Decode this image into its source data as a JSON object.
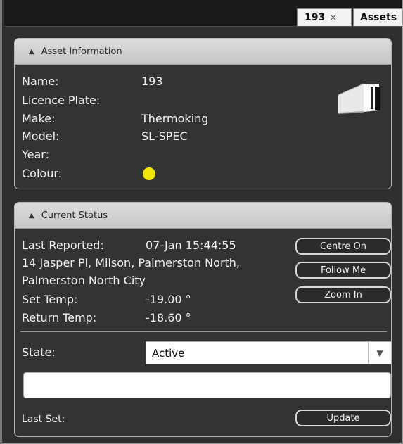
{
  "tabs": [
    {
      "label": "193",
      "close": "×"
    },
    {
      "label": "Assets"
    }
  ],
  "asset_info": {
    "header": "Asset Information",
    "fields": [
      {
        "label": "Name:",
        "value": "193"
      },
      {
        "label": "Licence Plate:",
        "value": ""
      },
      {
        "label": "Make:",
        "value": "Thermoking"
      },
      {
        "label": "Model:",
        "value": "SL-SPEC"
      },
      {
        "label": "Year:",
        "value": ""
      },
      {
        "label": "Colour:",
        "value": ""
      }
    ],
    "colour_value": "#f2e600",
    "icon": "truck-icon"
  },
  "status": {
    "header": "Current Status",
    "last_reported_label": "Last Reported:",
    "last_reported_value": "07-Jan 15:44:55",
    "address_line1": "14 Jasper Pl, Milson, Palmerston North,",
    "address_line2": "Palmerston North City",
    "set_temp_label": "Set Temp:",
    "set_temp_value": "-19.00 °",
    "return_temp_label": "Return Temp:",
    "return_temp_value": "-18.60 °",
    "buttons": {
      "centre_on": "Centre On",
      "follow_me": "Follow Me",
      "zoom_in": "Zoom In",
      "update": "Update"
    },
    "state_label": "State:",
    "state_value": "Active",
    "note_value": "",
    "last_set_label": "Last Set:"
  }
}
